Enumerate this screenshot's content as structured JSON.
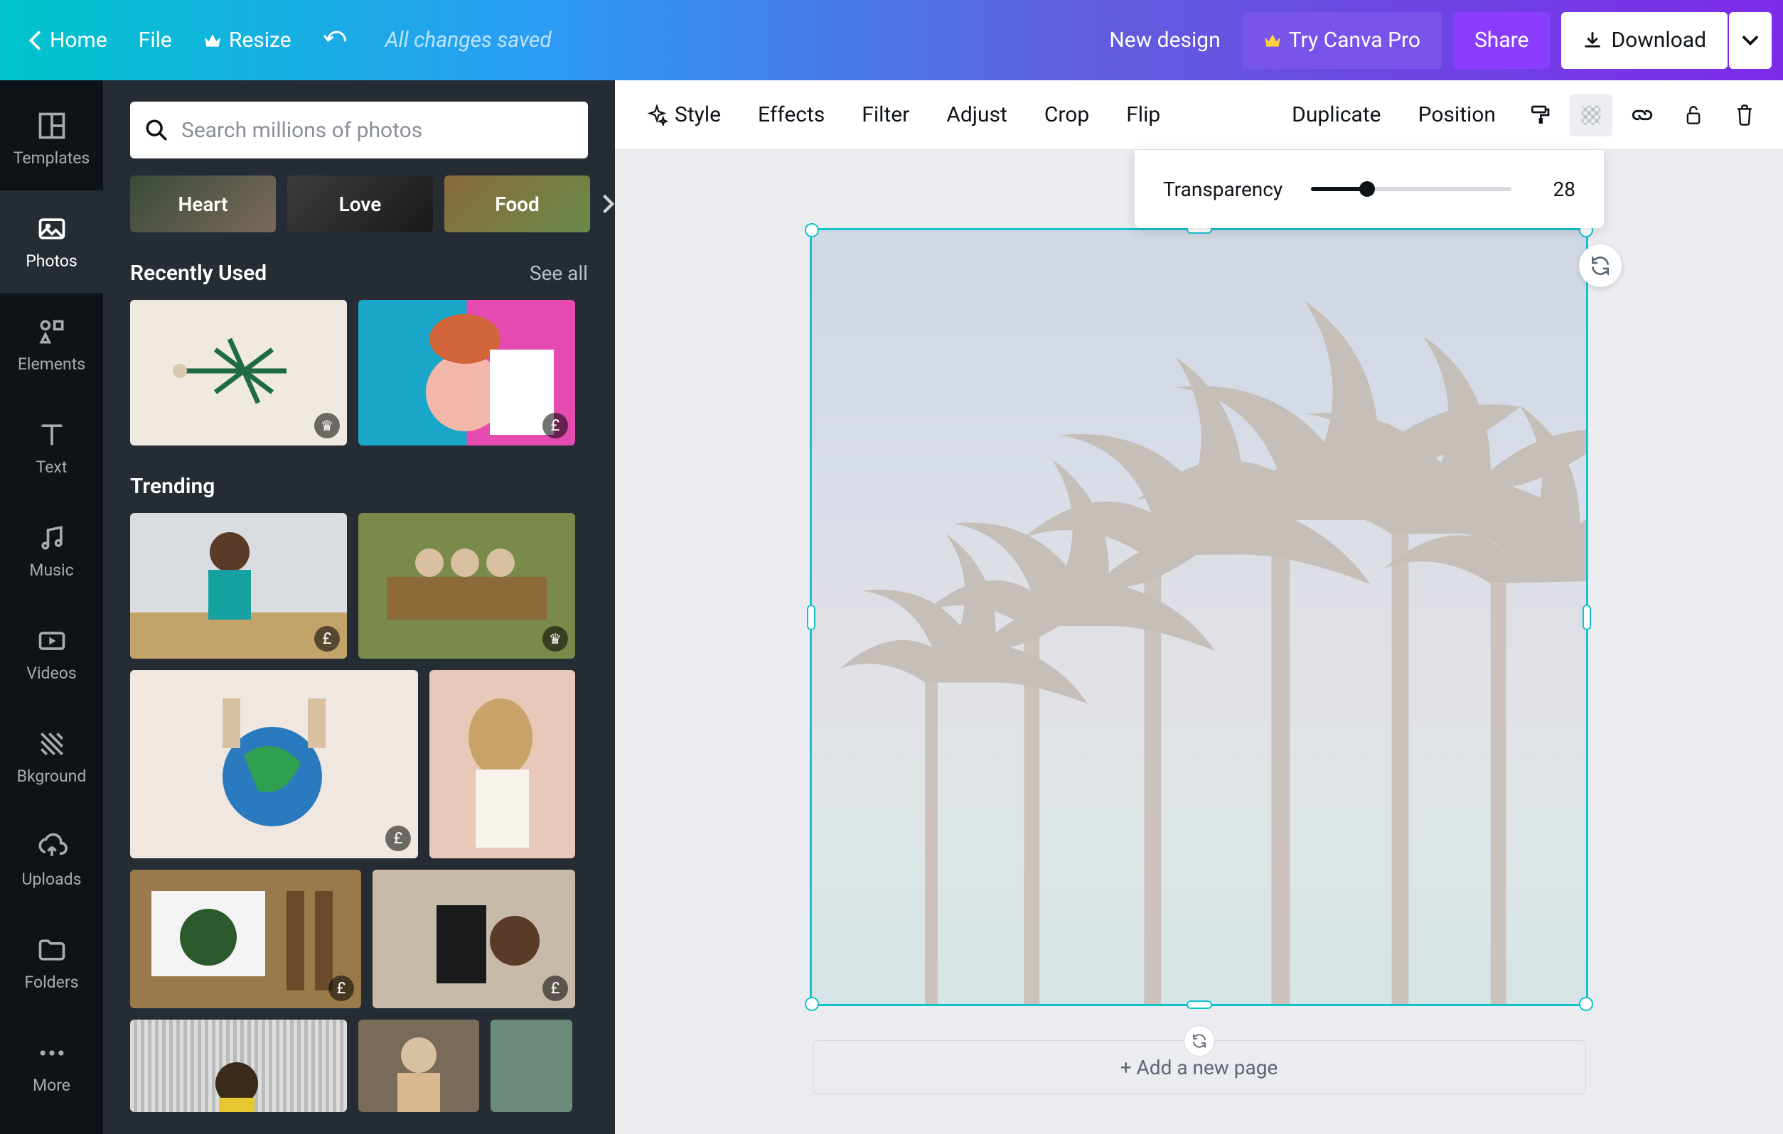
{
  "header": {
    "home": "Home",
    "file": "File",
    "resize": "Resize",
    "saved": "All changes saved",
    "newDesign": "New design",
    "tryPro": "Try Canva Pro",
    "share": "Share",
    "download": "Download"
  },
  "rail": {
    "items": [
      {
        "label": "Templates"
      },
      {
        "label": "Photos"
      },
      {
        "label": "Elements"
      },
      {
        "label": "Text"
      },
      {
        "label": "Music"
      },
      {
        "label": "Videos"
      },
      {
        "label": "Bkground"
      },
      {
        "label": "Uploads"
      },
      {
        "label": "Folders"
      },
      {
        "label": "More"
      }
    ],
    "activeIndex": 1
  },
  "panel": {
    "searchPlaceholder": "Search millions of photos",
    "pills": [
      "Heart",
      "Love",
      "Food"
    ],
    "sections": {
      "recent": {
        "title": "Recently Used",
        "seeAll": "See all"
      },
      "trending": {
        "title": "Trending"
      }
    },
    "badges": {
      "pound": "£",
      "crown": "♛"
    }
  },
  "context": {
    "style": "Style",
    "effects": "Effects",
    "filter": "Filter",
    "adjust": "Adjust",
    "crop": "Crop",
    "flip": "Flip",
    "duplicate": "Duplicate",
    "position": "Position"
  },
  "popover": {
    "label": "Transparency",
    "value": "28",
    "percent": 28
  },
  "canvas": {
    "addPage": "+ Add a new page"
  },
  "colors": {
    "selection": "#14c3ce"
  }
}
